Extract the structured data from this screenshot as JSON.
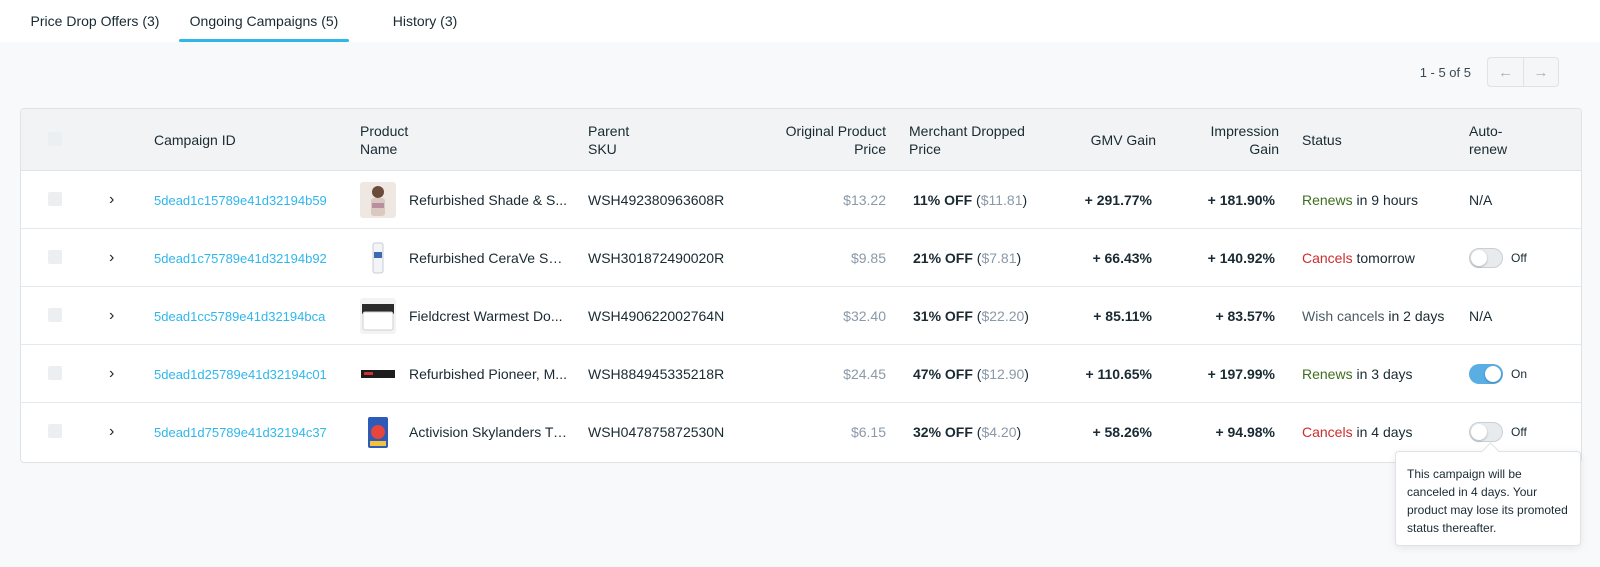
{
  "tabs": [
    {
      "label": "Price Drop Offers (3)",
      "active": false
    },
    {
      "label": "Ongoing Campaigns (5)",
      "active": true
    },
    {
      "label": "History (3)",
      "active": false
    }
  ],
  "pagination": {
    "text": "1 - 5 of 5",
    "prev_icon": "arrow-left-icon",
    "next_icon": "arrow-right-icon"
  },
  "columns": {
    "campaign_id": "Campaign ID",
    "product_name_1": "Product",
    "product_name_2": "Name",
    "parent_sku_1": "Parent",
    "parent_sku_2": "SKU",
    "original_price_1": "Original Product",
    "original_price_2": "Price",
    "dropped_price_1": "Merchant Dropped",
    "dropped_price_2": "Price",
    "gmv_gain": "GMV Gain",
    "impression_gain_1": "Impression",
    "impression_gain_2": "Gain",
    "status": "Status",
    "auto_renew_1": "Auto-",
    "auto_renew_2": "renew"
  },
  "rows": [
    {
      "campaign_id": "5dead1c15789e41d32194b59",
      "product_name": "Refurbished Shade & S...",
      "parent_sku": "WSH492380963608R",
      "original_price": "$13.22",
      "discount": "11% OFF",
      "dropped_price": "$11.81",
      "gmv_gain": "+ 291.77%",
      "impression_gain": "+ 181.90%",
      "status_word": "Renews",
      "status_rest": "in 9 hours",
      "status_type": "renews",
      "auto_renew": "N/A"
    },
    {
      "campaign_id": "5dead1c75789e41d32194b92",
      "product_name": "Refurbished CeraVe Ski...",
      "parent_sku": "WSH301872490020R",
      "original_price": "$9.85",
      "discount": "21% OFF",
      "dropped_price": "$7.81",
      "gmv_gain": "+ 66.43%",
      "impression_gain": "+ 140.92%",
      "status_word": "Cancels",
      "status_rest": "tomorrow",
      "status_type": "cancels",
      "auto_renew": "Off"
    },
    {
      "campaign_id": "5dead1cc5789e41d32194bca",
      "product_name": "Fieldcrest Warmest Do...",
      "parent_sku": "WSH490622002764N",
      "original_price": "$32.40",
      "discount": "31% OFF",
      "dropped_price": "$22.20",
      "gmv_gain": "+ 85.11%",
      "impression_gain": "+ 83.57%",
      "status_word": "Wish cancels",
      "status_rest": "in 2 days",
      "status_type": "wish",
      "auto_renew": "N/A"
    },
    {
      "campaign_id": "5dead1d25789e41d32194c01",
      "product_name": "Refurbished Pioneer, M...",
      "parent_sku": "WSH884945335218R",
      "original_price": "$24.45",
      "discount": "47% OFF",
      "dropped_price": "$12.90",
      "gmv_gain": "+ 110.65%",
      "impression_gain": "+ 197.99%",
      "status_word": "Renews",
      "status_rest": "in 3 days",
      "status_type": "renews",
      "auto_renew": "On"
    },
    {
      "campaign_id": "5dead1d75789e41d32194c37",
      "product_name": "Activision Skylanders Tr...",
      "parent_sku": "WSH047875872530N",
      "original_price": "$6.15",
      "discount": "32% OFF",
      "dropped_price": "$4.20",
      "gmv_gain": "+ 58.26%",
      "impression_gain": "+ 94.98%",
      "status_word": "Cancels",
      "status_rest": "in 4 days",
      "status_type": "cancels",
      "auto_renew": "Off"
    }
  ],
  "tooltip": {
    "text": "This campaign will be canceled in 4 days. Your product may lose its promoted status thereafter."
  },
  "colors": {
    "accent": "#2fb7ec",
    "renews": "#3f6e1e",
    "cancels": "#cc2d2d",
    "toggle_on": "#59aee4"
  }
}
